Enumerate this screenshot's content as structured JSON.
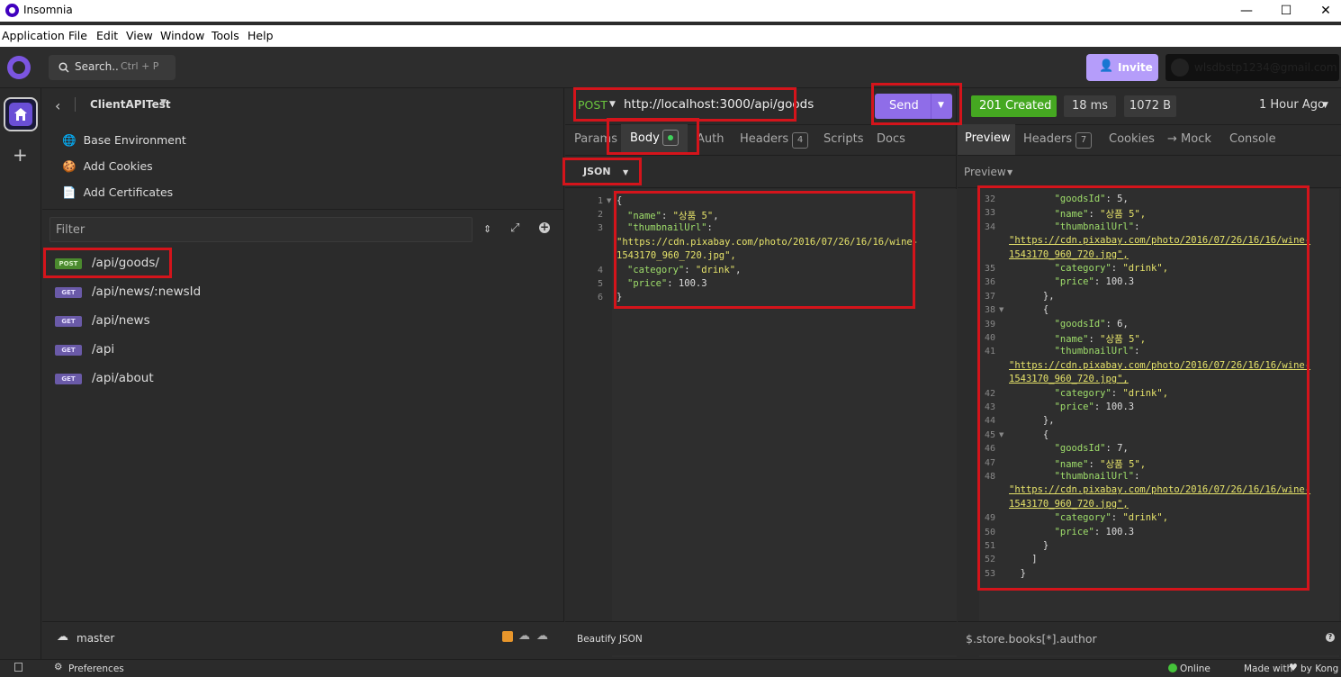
{
  "window": {
    "title": "Insomnia",
    "minimize": "—",
    "maximize": "☐",
    "close": "✕"
  },
  "menu": [
    "Application",
    "File",
    "Edit",
    "View",
    "Window",
    "Tools",
    "Help"
  ],
  "header": {
    "search_label": "Search..",
    "search_shortcut": "Ctrl + P",
    "invite_label": "Invite",
    "account_email": "wlsdbstp1234@gmail.com"
  },
  "sidebar": {
    "project": "ClientAPITest",
    "items": [
      "Base Environment",
      "Add Cookies",
      "Add Certificates"
    ],
    "filter_placeholder": "Filter",
    "requests": [
      {
        "method": "POST",
        "path": "/api/goods/"
      },
      {
        "method": "GET",
        "path": "/api/news/:newsId"
      },
      {
        "method": "GET",
        "path": "/api/news"
      },
      {
        "method": "GET",
        "path": "/api"
      },
      {
        "method": "GET",
        "path": "/api/about"
      }
    ],
    "environment": "master"
  },
  "request": {
    "method": "POST",
    "url": "http://localhost:3000/api/goods",
    "send_label": "Send",
    "tabs": {
      "params": "Params",
      "body": "Body",
      "auth": "Auth",
      "headers": "Headers",
      "headers_count": "4",
      "scripts": "Scripts",
      "docs": "Docs"
    },
    "body_type": "JSON",
    "code": [
      {
        "n": "1",
        "text": "{"
      },
      {
        "n": "2",
        "k": "\"name\"",
        "v": "\"상품 5\"",
        "end": ","
      },
      {
        "n": "3",
        "k": "\"thumbnailUrl\"",
        "v": "",
        "end": ":"
      },
      {
        "n": "",
        "text": "\"https://cdn.pixabay.com/photo/2016/07/26/16/16/wine-"
      },
      {
        "n": "",
        "text": "1543170_960_720.jpg\","
      },
      {
        "n": "4",
        "k": "\"category\"",
        "v": "\"drink\"",
        "end": ","
      },
      {
        "n": "5",
        "k": "\"price\"",
        "v": "100.3",
        "end": ""
      },
      {
        "n": "6",
        "text": "}"
      }
    ],
    "beautify_label": "Beautify JSON"
  },
  "response": {
    "status": "201 Created",
    "time": "18 ms",
    "size": "1072 B",
    "age": "1 Hour Ago",
    "tabs": {
      "preview": "Preview",
      "headers": "Headers",
      "headers_count": "7",
      "cookies": "Cookies",
      "mock": "→ Mock",
      "console": "Console"
    },
    "preview_mode": "Preview",
    "lines": [
      {
        "n": "32",
        "t": "        \"goodsId\": 5,"
      },
      {
        "n": "33",
        "t": "        \"name\": \"상품 5\","
      },
      {
        "n": "34",
        "t": "        \"thumbnailUrl\":"
      },
      {
        "n": "",
        "u": "\"https://cdn.pixabay.com/photo/2016/07/26/16/16/wine-"
      },
      {
        "n": "",
        "u": "1543170_960_720.jpg\","
      },
      {
        "n": "35",
        "t": "        \"category\": \"drink\","
      },
      {
        "n": "36",
        "t": "        \"price\": 100.3"
      },
      {
        "n": "37",
        "t": "      },"
      },
      {
        "n": "38",
        "t": "      {"
      },
      {
        "n": "39",
        "t": "        \"goodsId\": 6,"
      },
      {
        "n": "40",
        "t": "        \"name\": \"상품 5\","
      },
      {
        "n": "41",
        "t": "        \"thumbnailUrl\":"
      },
      {
        "n": "",
        "u": "\"https://cdn.pixabay.com/photo/2016/07/26/16/16/wine-"
      },
      {
        "n": "",
        "u": "1543170_960_720.jpg\","
      },
      {
        "n": "42",
        "t": "        \"category\": \"drink\","
      },
      {
        "n": "43",
        "t": "        \"price\": 100.3"
      },
      {
        "n": "44",
        "t": "      },"
      },
      {
        "n": "45",
        "t": "      {"
      },
      {
        "n": "46",
        "t": "        \"goodsId\": 7,"
      },
      {
        "n": "47",
        "t": "        \"name\": \"상품 5\","
      },
      {
        "n": "48",
        "t": "        \"thumbnailUrl\":"
      },
      {
        "n": "",
        "u": "\"https://cdn.pixabay.com/photo/2016/07/26/16/16/wine-"
      },
      {
        "n": "",
        "u": "1543170_960_720.jpg\","
      },
      {
        "n": "49",
        "t": "        \"category\": \"drink\","
      },
      {
        "n": "50",
        "t": "        \"price\": 100.3"
      },
      {
        "n": "51",
        "t": "      }"
      },
      {
        "n": "52",
        "t": "    ]"
      },
      {
        "n": "53",
        "t": "  }"
      }
    ],
    "filter_query": "$.store.books[*].author"
  },
  "statusbar": {
    "preferences": "Preferences",
    "online": "Online",
    "made_with": "Made with",
    "by": "by Kong"
  },
  "colors": {
    "accent": "#8f6de8",
    "post": "#4b8a2e",
    "get": "#6a5aa8",
    "success": "#45a821",
    "highlight": "#d4141b"
  }
}
